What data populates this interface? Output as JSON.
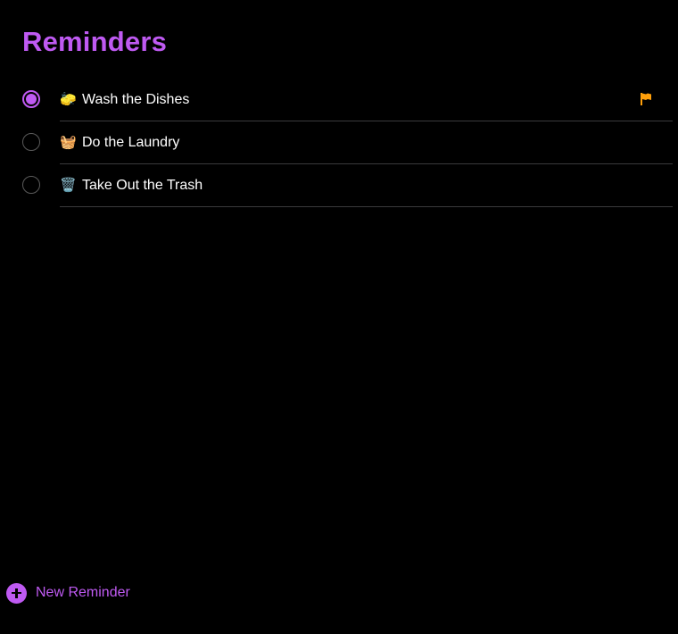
{
  "app": {
    "title": "Reminders",
    "accent_color": "#BF5AF2",
    "flag_color": "#FF9F0A"
  },
  "reminders": [
    {
      "emoji": "🧽",
      "title": "Wash the Dishes",
      "selected": true,
      "flagged": true,
      "flag_icon": "flag-icon"
    },
    {
      "emoji": "🧺",
      "title": "Do the Laundry",
      "selected": false,
      "flagged": false
    },
    {
      "emoji": "🗑️",
      "title": "Take Out the Trash",
      "selected": false,
      "flagged": false
    }
  ],
  "footer": {
    "new_reminder_label": "New Reminder",
    "new_reminder_icon": "plus-circle-icon"
  }
}
